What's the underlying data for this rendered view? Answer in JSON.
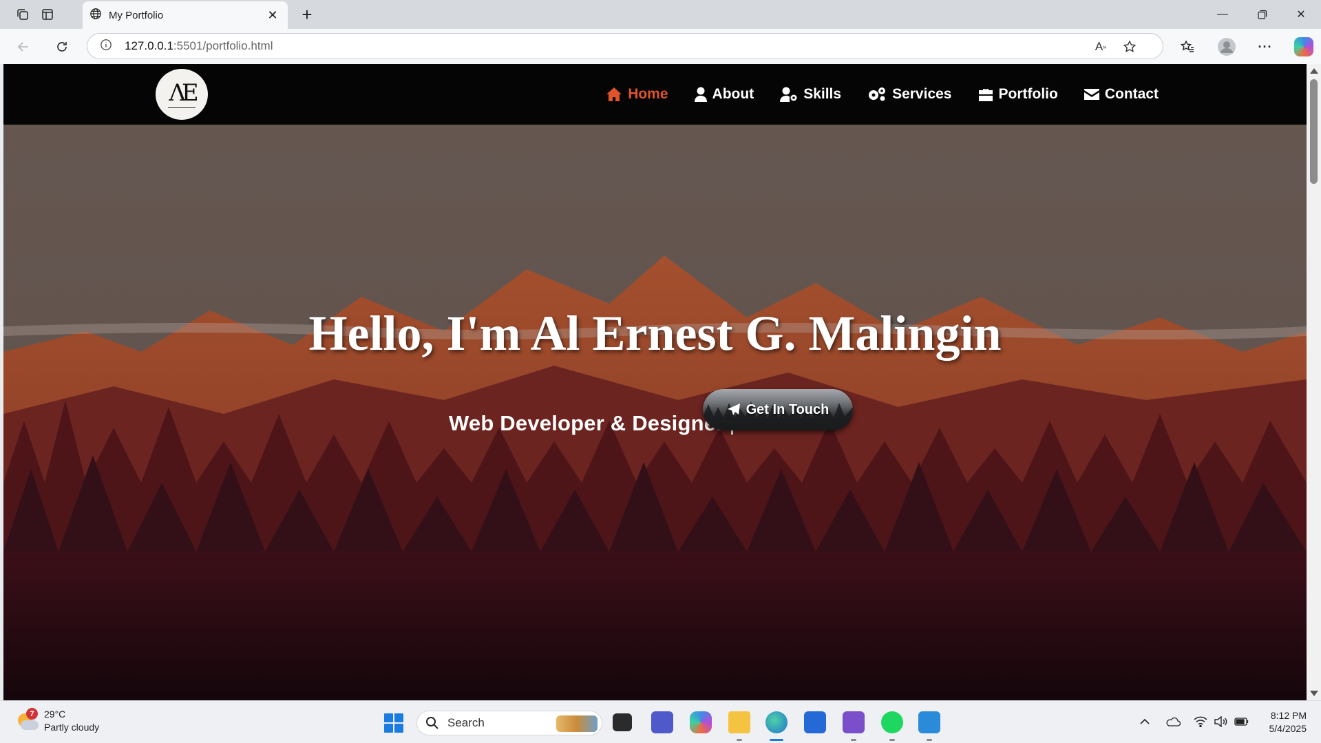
{
  "browser": {
    "tab_title": "My Portfolio",
    "url_host": "127.0.0.1",
    "url_rest": ":5501/portfolio.html"
  },
  "site": {
    "nav": [
      {
        "label": "Home",
        "icon": "home-icon",
        "active": true
      },
      {
        "label": "About",
        "icon": "user-icon",
        "active": false
      },
      {
        "label": "Skills",
        "icon": "user-gear-icon",
        "active": false
      },
      {
        "label": "Services",
        "icon": "gears-icon",
        "active": false
      },
      {
        "label": "Portfolio",
        "icon": "briefcase-icon",
        "active": false
      },
      {
        "label": "Contact",
        "icon": "envelope-icon",
        "active": false
      }
    ],
    "active_color": "#e0542a",
    "hero_title": "Hello, I'm Al Ernest G. Malingin",
    "hero_subtitle": "Web Developer & Designer",
    "cta_label": "Get In Touch"
  },
  "taskbar": {
    "weather_temp": "29°C",
    "weather_desc": "Partly cloudy",
    "weather_badge": "7",
    "search_placeholder": "Search",
    "time": "8:12 PM",
    "date": "5/4/2025"
  }
}
